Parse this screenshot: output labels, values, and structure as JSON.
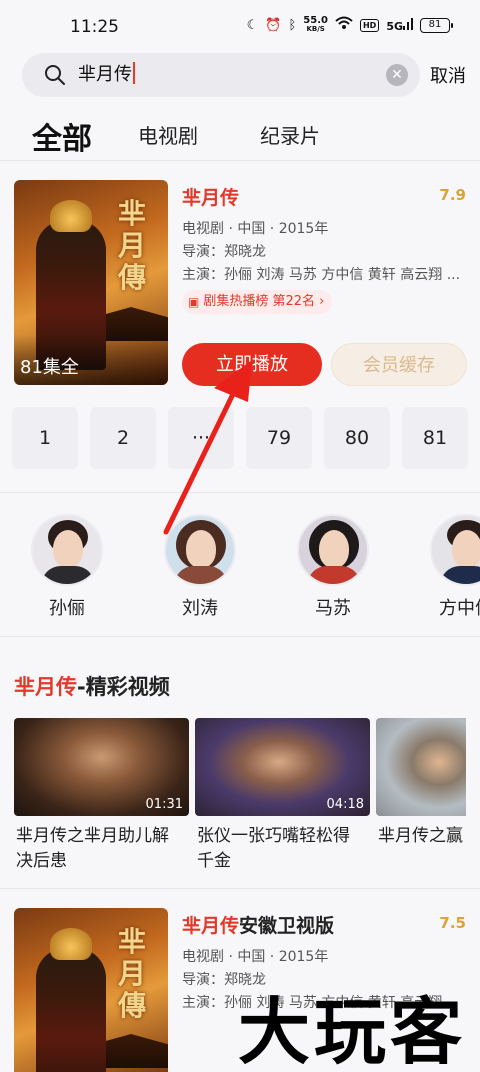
{
  "status_bar": {
    "time": "11:25",
    "net_speed": "55.0",
    "net_unit": "KB/S",
    "hd": "HD",
    "signal": "5G",
    "battery": "81"
  },
  "search": {
    "query": "芈月传",
    "cancel_label": "取消"
  },
  "tabs": [
    {
      "label": "全部",
      "active": true
    },
    {
      "label": "电视剧",
      "active": false
    },
    {
      "label": "纪录片",
      "active": false
    }
  ],
  "result1": {
    "title": "芈月传",
    "score": "7.9",
    "episode_badge": "81集全",
    "poster_title": "芈月傳",
    "meta_line": "电视剧 · 中国 · 2015年",
    "director": "导演：郑晓龙",
    "cast": "主演：孙俪 刘涛 马苏 方中信 黄轩 高云翔 ...",
    "rank_label": "剧集热播榜 第22名 ›",
    "play_label": "立即播放",
    "cache_label": "会员缓存",
    "episodes": [
      "1",
      "2",
      "···",
      "79",
      "80",
      "81"
    ]
  },
  "cast_members": [
    {
      "name": "孙俪"
    },
    {
      "name": "刘涛"
    },
    {
      "name": "马苏"
    },
    {
      "name": "方中信"
    }
  ],
  "section": {
    "title_highlight": "芈月传",
    "title_rest": "-精彩视频"
  },
  "videos": [
    {
      "duration": "01:31",
      "title_line1": "芈月传之芈月助儿解",
      "title_line2": "决后患"
    },
    {
      "duration": "04:18",
      "title_line1": "张仪一张巧嘴轻松得",
      "title_line2": "千金"
    },
    {
      "duration": "",
      "title_line1": "芈月传之赢",
      "title_line2": ""
    }
  ],
  "result2": {
    "title": "芈月传",
    "title_extra": "安徽卫视版",
    "score": "7.5",
    "poster_title": "芈月傳",
    "meta_line": "电视剧 · 中国 · 2015年",
    "director": "导演：郑晓龙",
    "cast": "主演：孙俪 刘涛 马苏 方中信 黄轩 高云翔"
  },
  "watermark": "大玩客",
  "colors": {
    "accent": "#e52d20",
    "score": "#d9a23a",
    "cache_text": "#d9b98d"
  }
}
